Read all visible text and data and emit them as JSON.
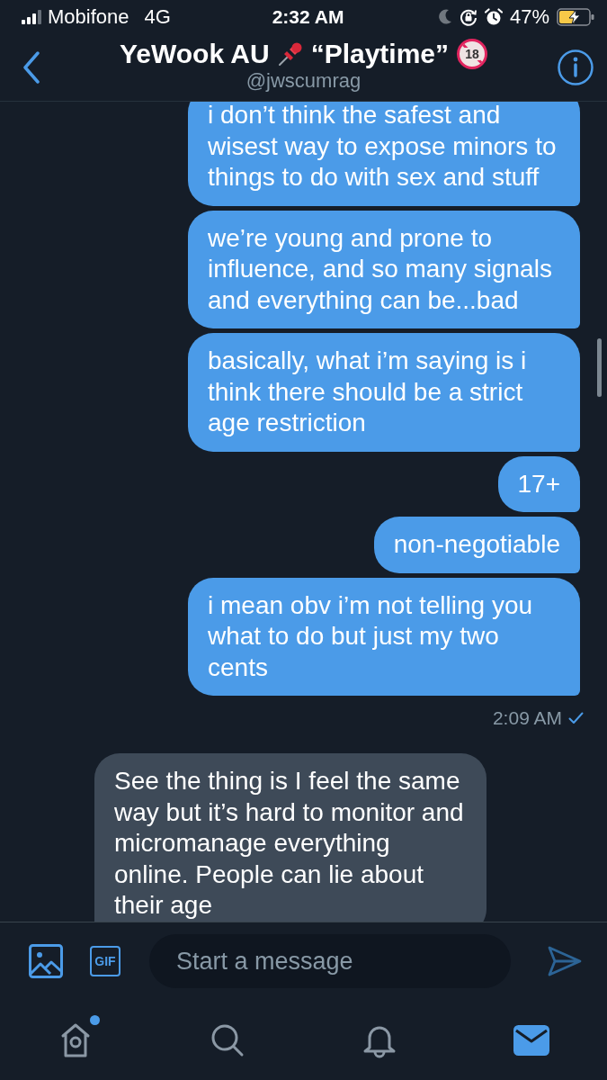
{
  "status_bar": {
    "carrier": "Mobifone",
    "network": "4G",
    "time": "2:32 AM",
    "battery": "47%"
  },
  "header": {
    "title": "YeWook AU",
    "title_tag": "“Playtime”",
    "age_badge": "18",
    "handle": "@jwscumrag"
  },
  "messages": [
    {
      "kind": "sent",
      "text": "i don’t think the safest and wisest way to expose minors to things to do with sex and stuff"
    },
    {
      "kind": "sent",
      "text": "we’re young and prone to influence, and so many signals and everything can be...bad"
    },
    {
      "kind": "sent",
      "text": "basically, what i’m saying is i think there should be a strict age restriction"
    },
    {
      "kind": "sent",
      "text": "17+"
    },
    {
      "kind": "sent",
      "text": "non-negotiable"
    },
    {
      "kind": "sent",
      "text": "i mean obv i’m not telling you what to do but just my two cents"
    },
    {
      "kind": "timestamp",
      "text": "2:09 AM"
    },
    {
      "kind": "received",
      "text": "See the thing is I feel the same way but it’s hard to monitor and micromanage everything online. People can lie about their age"
    }
  ],
  "composer": {
    "gif_label": "GIF",
    "placeholder": "Start a message"
  },
  "tabs": [
    {
      "kind": "home",
      "selected": false,
      "unread": true
    },
    {
      "kind": "search",
      "selected": false,
      "unread": false
    },
    {
      "kind": "notifications",
      "selected": false,
      "unread": false
    },
    {
      "kind": "messages",
      "selected": true,
      "unread": false
    }
  ]
}
